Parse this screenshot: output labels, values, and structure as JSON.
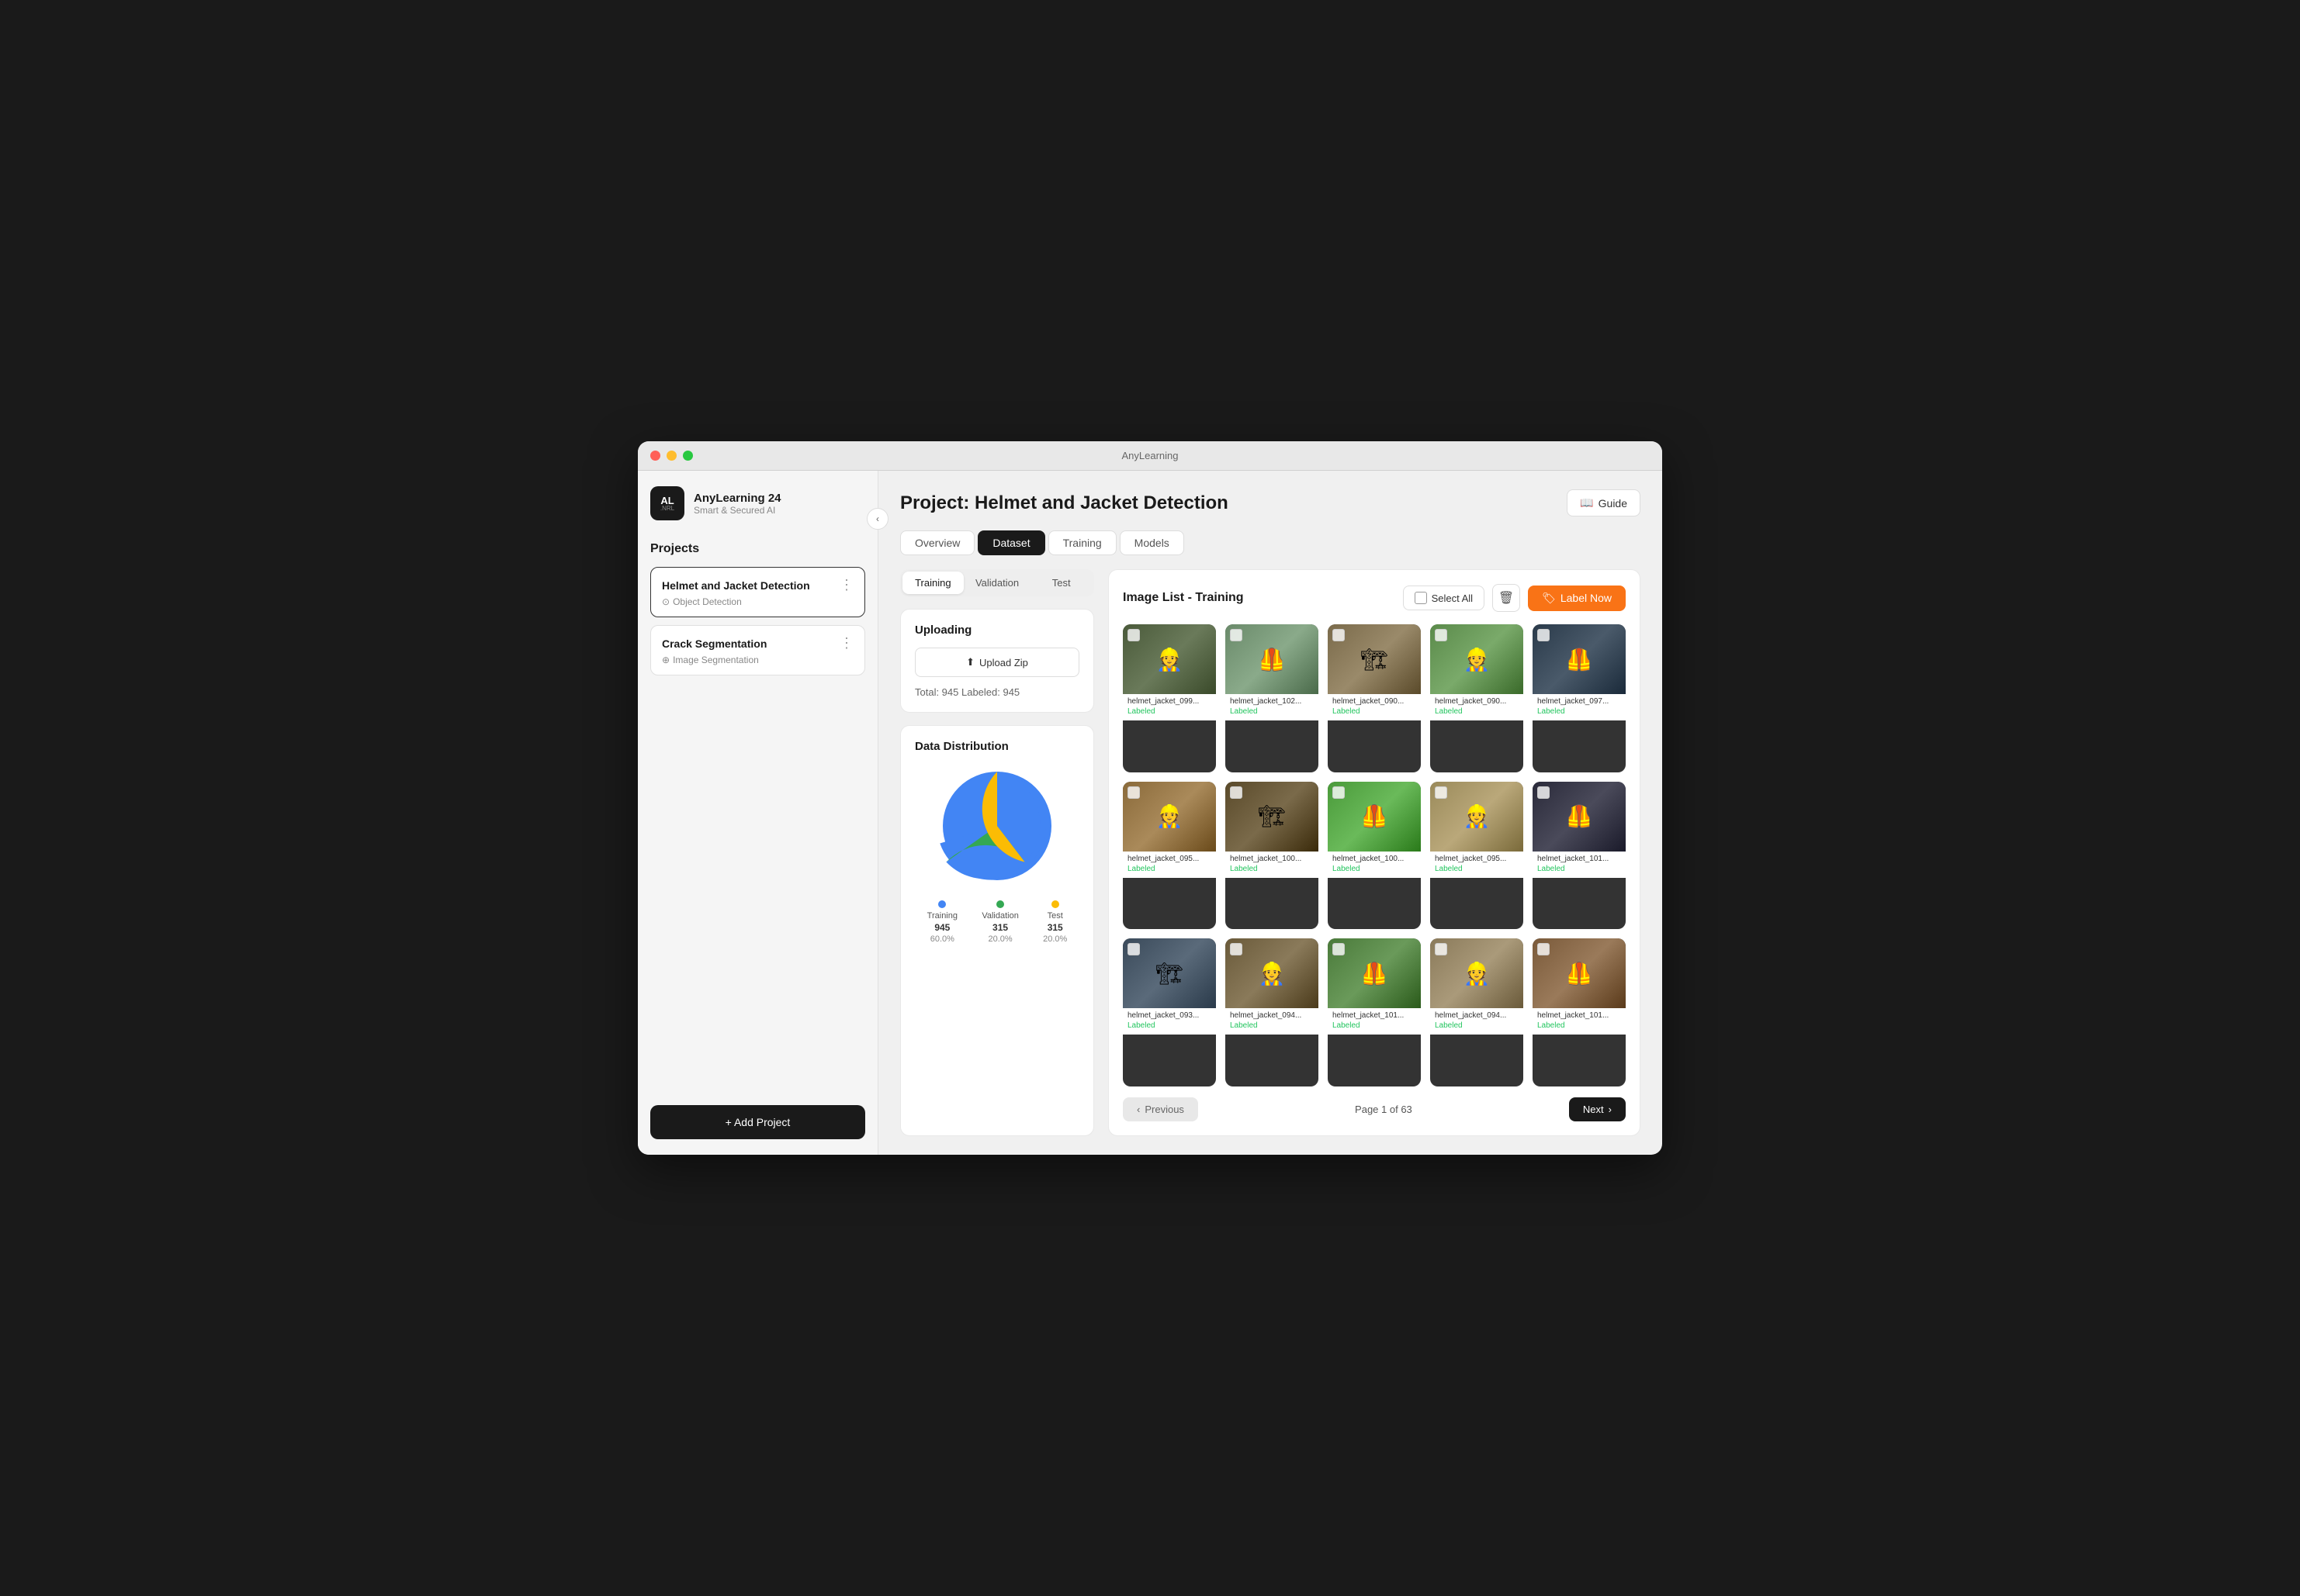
{
  "app": {
    "title": "AnyLearning",
    "name": "AnyLearning 24",
    "sub": "Smart & Secured AI",
    "logo_main": "AL",
    "logo_sub": ".NRL"
  },
  "sidebar": {
    "section_title": "Projects",
    "projects": [
      {
        "name": "Helmet and Jacket Detection",
        "type": "Object Detection",
        "active": true,
        "icon": "⊙"
      },
      {
        "name": "Crack Segmentation",
        "type": "Image Segmentation",
        "active": false,
        "icon": "⊕"
      }
    ],
    "add_btn": "+ Add Project",
    "collapse_icon": "‹"
  },
  "header": {
    "project_label": "Project:",
    "project_name": "Helmet and Jacket Detection",
    "guide_btn": "Guide",
    "guide_icon": "📖"
  },
  "nav_tabs": [
    {
      "label": "Overview",
      "active": false
    },
    {
      "label": "Dataset",
      "active": true
    },
    {
      "label": "Training",
      "active": false
    },
    {
      "label": "Models",
      "active": false
    }
  ],
  "sub_tabs": [
    {
      "label": "Training",
      "active": true
    },
    {
      "label": "Validation",
      "active": false
    },
    {
      "label": "Test",
      "active": false
    }
  ],
  "upload": {
    "title": "Uploading",
    "btn_label": "Upload Zip",
    "upload_icon": "⬆",
    "stats": "Total: 945   Labeled: 945"
  },
  "distribution": {
    "title": "Data Distribution",
    "segments": [
      {
        "label": "Training",
        "count": "945",
        "pct": "60.0%",
        "color": "#4285f4"
      },
      {
        "label": "Validation",
        "count": "315",
        "pct": "20.0%",
        "color": "#34a853"
      },
      {
        "label": "Test",
        "count": "315",
        "pct": "20.0%",
        "color": "#fbbc04"
      }
    ]
  },
  "image_list": {
    "title": "Image List - Training",
    "select_all": "Select All",
    "label_now": "Label Now",
    "delete_icon": "🗑",
    "images": [
      {
        "name": "helmet_jacket_099...",
        "label": "Labeled",
        "bg": "#5a6a4a"
      },
      {
        "name": "helmet_jacket_102...",
        "label": "Labeled",
        "bg": "#7a8a6a"
      },
      {
        "name": "helmet_jacket_090...",
        "label": "Labeled",
        "bg": "#8a7a5a"
      },
      {
        "name": "helmet_jacket_090...",
        "label": "Labeled",
        "bg": "#6a8a4a"
      },
      {
        "name": "helmet_jacket_097...",
        "label": "Labeled",
        "bg": "#2a3a4a"
      },
      {
        "name": "helmet_jacket_095...",
        "label": "Labeled",
        "bg": "#8a6a3a"
      },
      {
        "name": "helmet_jacket_100...",
        "label": "Labeled",
        "bg": "#5a4a2a"
      },
      {
        "name": "helmet_jacket_100...",
        "label": "Labeled",
        "bg": "#4a8a3a"
      },
      {
        "name": "helmet_jacket_095...",
        "label": "Labeled",
        "bg": "#9a8a5a"
      },
      {
        "name": "helmet_jacket_101...",
        "label": "Labeled",
        "bg": "#2a2a3a"
      },
      {
        "name": "helmet_jacket_093...",
        "label": "Labeled",
        "bg": "#3a4a5a"
      },
      {
        "name": "helmet_jacket_094...",
        "label": "Labeled",
        "bg": "#6a5a3a"
      },
      {
        "name": "helmet_jacket_101...",
        "label": "Labeled",
        "bg": "#4a6a3a"
      },
      {
        "name": "helmet_jacket_094...",
        "label": "Labeled",
        "bg": "#8a6a5a"
      },
      {
        "name": "helmet_jacket_101...",
        "label": "Labeled",
        "bg": "#7a4a3a"
      }
    ],
    "pagination": {
      "prev": "Previous",
      "next": "Next",
      "current": "Page 1 of 63"
    }
  }
}
